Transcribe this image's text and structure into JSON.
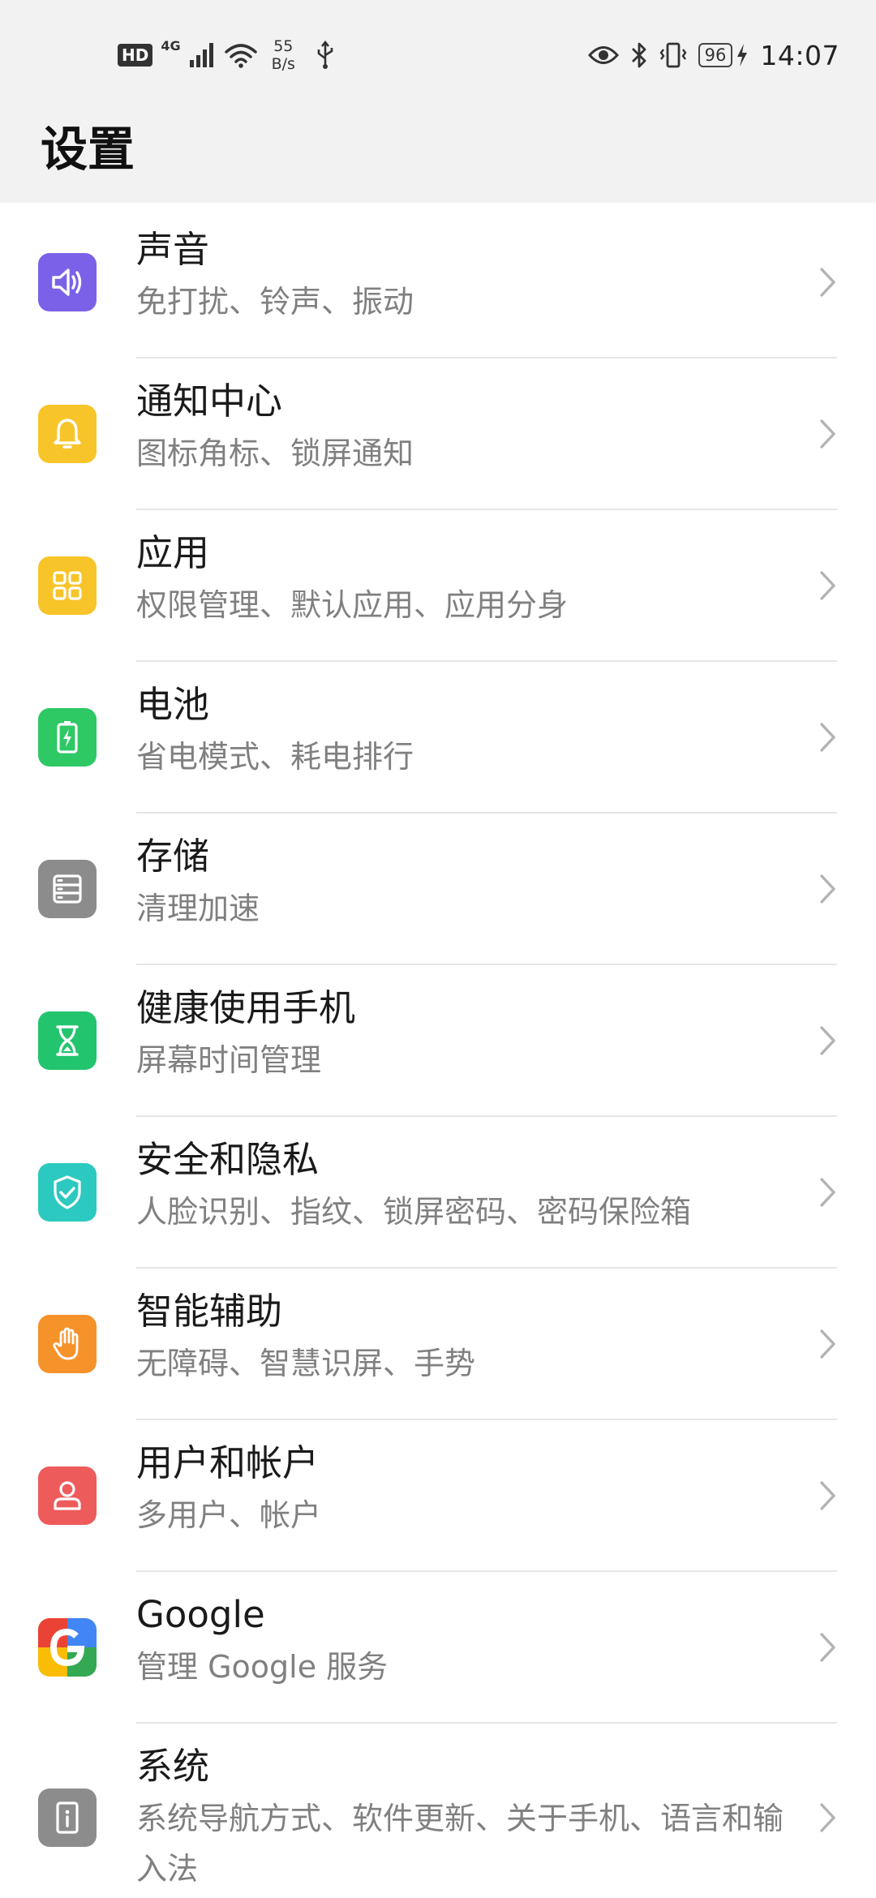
{
  "status_bar": {
    "hd_label": "HD",
    "network_type": "4G",
    "speed_value": "55",
    "speed_unit": "B/s",
    "battery_level": "96",
    "time": "14:07"
  },
  "header": {
    "title": "设置"
  },
  "settings": [
    {
      "title": "声音",
      "subtitle": "免打扰、铃声、振动",
      "icon": "speaker-icon",
      "icon_color": "#7b61e8"
    },
    {
      "title": "通知中心",
      "subtitle": "图标角标、锁屏通知",
      "icon": "bell-icon",
      "icon_color": "#f7c42a"
    },
    {
      "title": "应用",
      "subtitle": "权限管理、默认应用、应用分身",
      "icon": "apps-grid-icon",
      "icon_color": "#f7c42a"
    },
    {
      "title": "电池",
      "subtitle": "省电模式、耗电排行",
      "icon": "battery-icon",
      "icon_color": "#2ec865"
    },
    {
      "title": "存储",
      "subtitle": "清理加速",
      "icon": "storage-icon",
      "icon_color": "#8c8c8c"
    },
    {
      "title": "健康使用手机",
      "subtitle": "屏幕时间管理",
      "icon": "hourglass-icon",
      "icon_color": "#23c46e"
    },
    {
      "title": "安全和隐私",
      "subtitle": "人脸识别、指纹、锁屏密码、密码保险箱",
      "icon": "shield-check-icon",
      "icon_color": "#2cc9c0"
    },
    {
      "title": "智能辅助",
      "subtitle": "无障碍、智慧识屏、手势",
      "icon": "hand-icon",
      "icon_color": "#f5932a"
    },
    {
      "title": "用户和帐户",
      "subtitle": "多用户、帐户",
      "icon": "user-icon",
      "icon_color": "#ee5b5b"
    },
    {
      "title": "Google",
      "subtitle": "管理 Google 服务",
      "icon": "google-icon",
      "icon_color": "#ffffff"
    },
    {
      "title": "系统",
      "subtitle": "系统导航方式、软件更新、关于手机、语言和输入法",
      "icon": "system-icon",
      "icon_color": "#8c8c8c"
    }
  ]
}
